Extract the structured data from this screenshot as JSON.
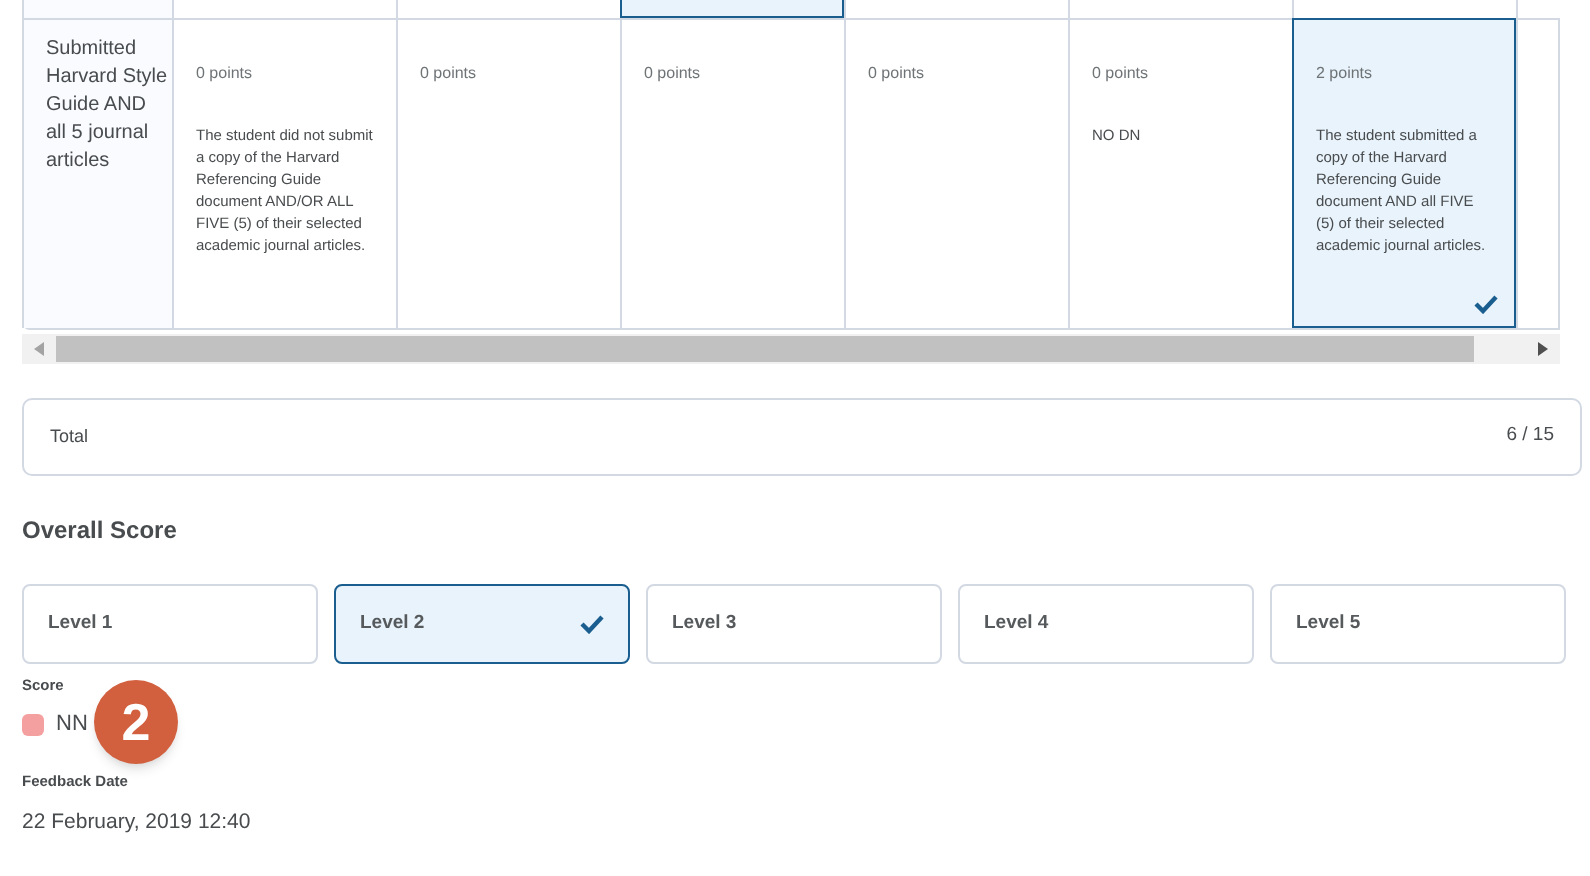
{
  "rubric": {
    "row_above": [
      {
        "selected": false
      },
      {
        "selected": false
      },
      {
        "selected": true
      },
      {
        "selected": false
      },
      {
        "selected": false
      },
      {
        "selected": false
      }
    ],
    "criterion": "Submitted Harvard Style Guide AND all 5 journal articles",
    "cells": [
      {
        "points": "0 points",
        "description": "The student did not submit a copy of the Harvard Referencing Guide document AND/OR ALL FIVE (5) of their selected academic journal articles.",
        "selected": false
      },
      {
        "points": "0 points",
        "selected": false
      },
      {
        "points": "0 points",
        "selected": false
      },
      {
        "points": "0 points",
        "selected": false
      },
      {
        "points": "0 points",
        "description": "NO DN",
        "selected": false
      },
      {
        "points": "2 points",
        "description": "The student submitted a copy of the Harvard Referencing Guide document AND all FIVE (5) of their selected academic journal articles.",
        "selected": true
      }
    ]
  },
  "total": {
    "label": "Total",
    "value": "6 / 15"
  },
  "overall_score": {
    "title": "Overall Score",
    "levels": [
      {
        "label": "Level 1",
        "selected": false
      },
      {
        "label": "Level 2",
        "selected": true
      },
      {
        "label": "Level 3",
        "selected": false
      },
      {
        "label": "Level 4",
        "selected": false
      },
      {
        "label": "Level 5",
        "selected": false
      }
    ]
  },
  "score": {
    "label": "Score",
    "value": "NN",
    "color": "#f4a0a0"
  },
  "callout": "2",
  "feedback_date": {
    "label": "Feedback Date",
    "value": "22 February, 2019 12:40"
  }
}
